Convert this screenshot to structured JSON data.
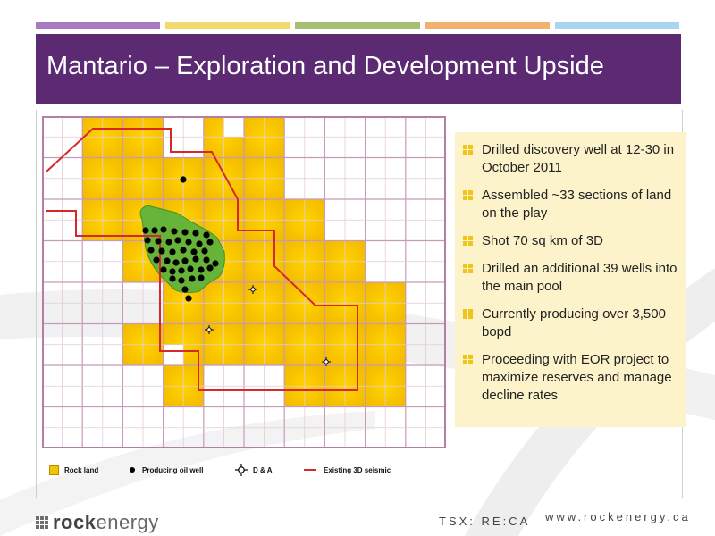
{
  "slide": {
    "title": "Mantario – Exploration and Development Upside",
    "colors": {
      "title_bg": "#5b2a73",
      "bars": [
        "#a77bbf",
        "#f2da6e",
        "#a7bf73",
        "#f2b26b",
        "#a9d6ef"
      ],
      "rock_land": "#f4c400",
      "producing_area": "#5fb33b",
      "seismic": "#d62828",
      "grid": "#c79ab8",
      "bullet_bg": "#fdf3cb"
    }
  },
  "map": {
    "legend": {
      "rock_land": "Rock land",
      "producing_well": "Producing oil well",
      "dna": "D & A",
      "seismic": "Existing 3D seismic"
    }
  },
  "bullets": [
    "Drilled discovery well at 12-30 in October 2011",
    "Assembled ~33 sections of land on the play",
    "Shot 70 sq km of 3D",
    "Drilled an additional 39 wells into the main pool",
    "Currently producing over 3,500 bopd",
    "Proceeding with EOR project to maximize reserves and manage decline rates"
  ],
  "footer": {
    "logo_bold": "rock",
    "logo_light": "energy",
    "ticker": "TSX: RE:CA",
    "url": "www.rockenergy.ca"
  }
}
